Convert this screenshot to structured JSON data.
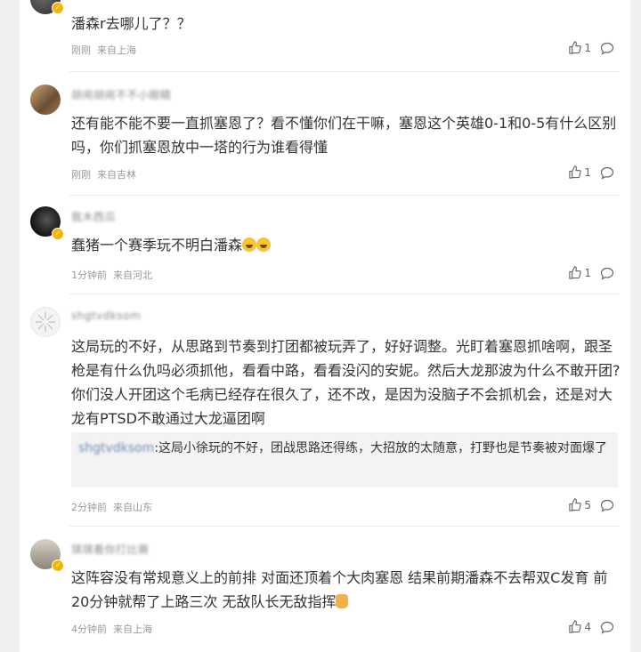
{
  "comments": [
    {
      "username": "",
      "text": "潘森r去哪儿了？？",
      "time": "刚刚",
      "location": "来自上海",
      "likes": "1",
      "reply": null
    },
    {
      "username": "胡闹胡闹不不小眼睛",
      "text": "还有能不能不要一直抓塞恩了？看不懂你们在干嘛，塞恩这个英雄0-1和0-5有什么区别吗，你们抓塞恩放中一塔的行为谁看得懂",
      "time": "刚刚",
      "location": "来自吉林",
      "likes": "1",
      "reply": null
    },
    {
      "username": "我木西瓜",
      "text": "蠢猪一个赛季玩不明白潘森",
      "time": "1分钟前",
      "location": "来自河北",
      "likes": "1",
      "reply": null
    },
    {
      "username": "shgtvdksom",
      "text": "这局玩的不好，从思路到节奏到打团都被玩弄了，好好调整。光盯着塞恩抓啥啊，跟圣枪是有什么仇吗必须抓他，看看中路，看看没闪的安妮。然后大龙那波为什么不敢开团?你们没人开团这个毛病已经存在很久了，还不改，是因为没脑子不会抓机会，还是对大龙有PTSD不敢通过大龙逼团啊",
      "time": "2分钟前",
      "location": "来自山东",
      "likes": "5",
      "reply": {
        "name": "shgtvdksom",
        "text": ":这局小徐玩的不好，团战思路还得练，大招放的太随意，打野也是节奏被对面爆了"
      }
    },
    {
      "username": "琪琪看你打比赛",
      "text": "这阵容没有常规意义上的前排 对面还顶着个大肉塞恩 结果前期潘森不去帮双C发育 前20分钟就帮了上路三次 无敌队长无敌指挥",
      "time": "4分钟前",
      "location": "来自上海",
      "likes": "4",
      "reply": null
    }
  ],
  "colors": {
    "background": "#f0f0f0",
    "panel": "#ffffff",
    "text": "#333333",
    "meta": "#999999",
    "reply_bg": "#f3f3f3",
    "reply_name": "#6f8bb5",
    "badge": "#f6b300"
  },
  "icons": [
    "thumbs-up-icon",
    "comment-bubble-icon",
    "verified-badge-icon",
    "laughing-emoji-icon",
    "thumbs-up-emoji-icon"
  ]
}
